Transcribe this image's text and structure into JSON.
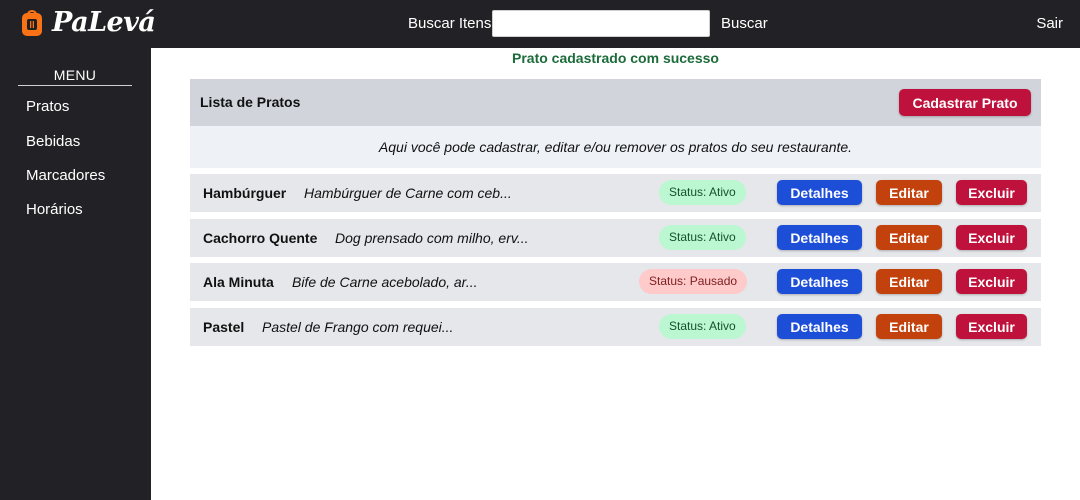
{
  "header": {
    "brand": "PaLevá",
    "search_label": "Buscar Itens",
    "search_value": "",
    "search_button": "Buscar",
    "logout": "Sair"
  },
  "sidebar": {
    "title": "MENU",
    "items": [
      {
        "label": "Pratos"
      },
      {
        "label": "Bebidas"
      },
      {
        "label": "Marcadores"
      },
      {
        "label": "Horários"
      }
    ]
  },
  "main": {
    "flash": "Prato cadastrado com sucesso",
    "list_title": "Lista de Pratos",
    "new_button": "Cadastrar Prato",
    "description": "Aqui você pode cadastrar, editar e/ou remover os pratos do seu restaurante.",
    "rows": [
      {
        "name": "Hambúrguer",
        "desc": "Hambúrguer de Carne com ceb...",
        "status": "Status: Ativo",
        "details": "Detalhes",
        "edit": "Editar",
        "delete": "Excluir"
      },
      {
        "name": "Cachorro Quente",
        "desc": "Dog prensado com milho, erv...",
        "status": "Status: Ativo",
        "details": "Detalhes",
        "edit": "Editar",
        "delete": "Excluir"
      },
      {
        "name": "Ala Minuta",
        "desc": "Bife de Carne acebolado, ar...",
        "status": "Status: Pausado",
        "details": "Detalhes",
        "edit": "Editar",
        "delete": "Excluir"
      },
      {
        "name": "Pastel",
        "desc": "Pastel de Frango com requei...",
        "status": "Status: Ativo",
        "details": "Detalhes",
        "edit": "Editar",
        "delete": "Excluir"
      }
    ]
  },
  "colors": {
    "dark": "#222226",
    "success": "#1c6b3a",
    "primary": "#1d4ed8",
    "warning": "#c2410c",
    "danger": "#be123c"
  },
  "icons": {
    "logo": "backpack-icon"
  }
}
